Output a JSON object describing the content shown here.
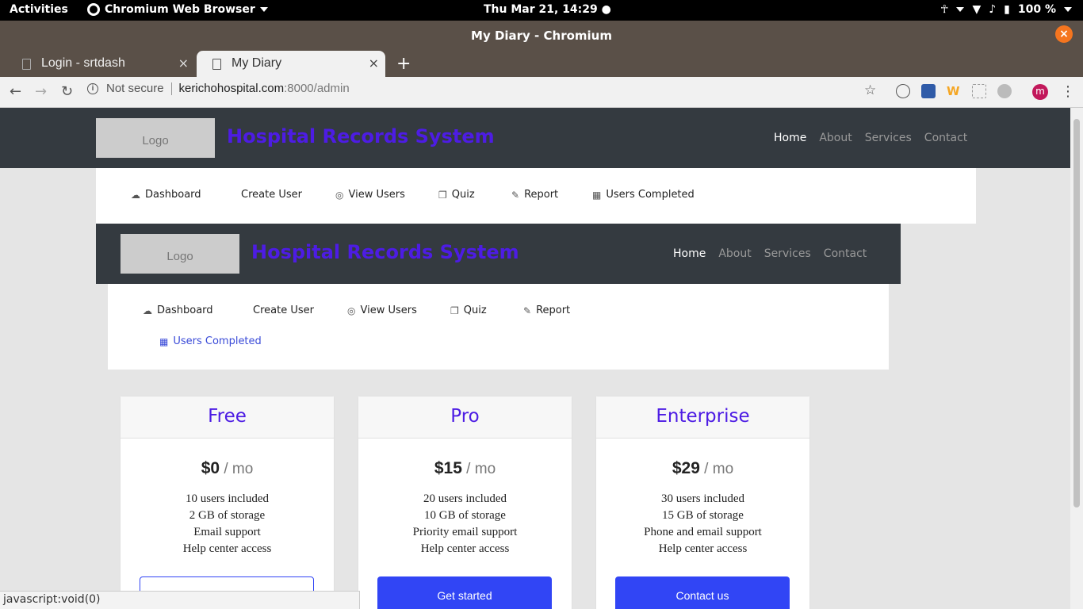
{
  "system_bar": {
    "activities": "Activities",
    "app_name": "Chromium Web Browser",
    "clock": "Thu Mar 21, 14:29 ●",
    "battery": "100 %"
  },
  "window": {
    "title": "My Diary - Chromium",
    "close_glyph": "×"
  },
  "tabs": [
    {
      "label": "Login - srtdash",
      "close": "×"
    },
    {
      "label": "My Diary",
      "close": "×"
    }
  ],
  "new_tab": "+",
  "address_bar": {
    "security_label": "Not secure",
    "host": "kerichohospital.com",
    "path": ":8000/admin",
    "profile_initial": "m"
  },
  "header_1": {
    "logo": "Logo",
    "brand": "Hospital Records System",
    "nav": [
      "Home",
      "About",
      "Services",
      "Contact"
    ]
  },
  "subnav_1": [
    {
      "icon": "☁",
      "label": "Dashboard"
    },
    {
      "icon": "",
      "label": "Create User"
    },
    {
      "icon": "◎",
      "label": "View Users"
    },
    {
      "icon": "❐",
      "label": "Quiz"
    },
    {
      "icon": "✎",
      "label": "Report"
    },
    {
      "icon": "▦",
      "label": "Users Completed"
    }
  ],
  "header_2": {
    "logo": "Logo",
    "brand": "Hospital Records System",
    "nav": [
      "Home",
      "About",
      "Services",
      "Contact"
    ]
  },
  "subnav_2": [
    {
      "icon": "☁",
      "label": "Dashboard"
    },
    {
      "icon": "",
      "label": "Create User"
    },
    {
      "icon": "◎",
      "label": "View Users"
    },
    {
      "icon": "❐",
      "label": "Quiz"
    },
    {
      "icon": "✎",
      "label": "Report"
    },
    {
      "icon": "▦",
      "label": "Users Completed"
    }
  ],
  "pricing": [
    {
      "name": "Free",
      "amount": "$0",
      "period": " / mo",
      "features": [
        "10 users included",
        "2 GB of storage",
        "Email support",
        "Help center access"
      ],
      "button": ""
    },
    {
      "name": "Pro",
      "amount": "$15",
      "period": " / mo",
      "features": [
        "20 users included",
        "10 GB of storage",
        "Priority email support",
        "Help center access"
      ],
      "button": "Get started"
    },
    {
      "name": "Enterprise",
      "amount": "$29",
      "period": " / mo",
      "features": [
        "30 users included",
        "15 GB of storage",
        "Phone and email support",
        "Help center access"
      ],
      "button": "Contact us"
    }
  ],
  "status_text": "javascript:void(0)",
  "colors": {
    "brand": "#4d1ce4",
    "accent_button": "#3145f5",
    "header_bg": "#343a40"
  }
}
